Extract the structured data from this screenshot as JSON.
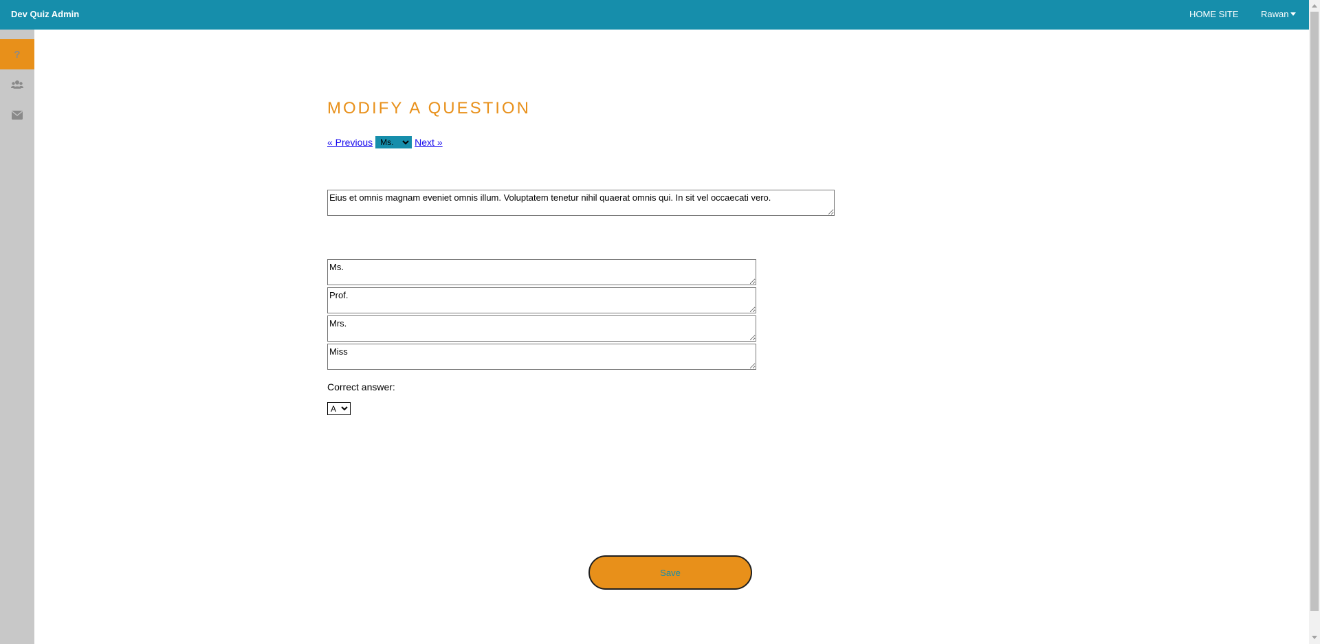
{
  "app": {
    "brand": "Dev Quiz Admin",
    "home_site": "HOME SITE",
    "user_name": "Rawan"
  },
  "sidebar": {
    "items": [
      {
        "icon": "question-icon",
        "glyph": "?",
        "active": true
      },
      {
        "icon": "users-icon",
        "active": false
      },
      {
        "icon": "envelope-icon",
        "active": false
      }
    ]
  },
  "page": {
    "title": "MODIFY A QUESTION",
    "prev_label": "« Previous",
    "next_label": "Next »",
    "question_select": {
      "selected": "Ms."
    },
    "question_text": "Eius et omnis magnam eveniet omnis illum. Voluptatem tenetur nihil quaerat omnis qui. In sit vel occaecati vero.",
    "answers": [
      "Ms.",
      "Prof.",
      "Mrs.",
      "Miss"
    ],
    "correct_answer_label": "Correct answer:",
    "correct_answer": {
      "selected": "A"
    },
    "save_label": "Save"
  },
  "colors": {
    "header": "#168eab",
    "accent": "#e8901a",
    "sidebar": "#c8c8c8",
    "link": "#1a0dee"
  }
}
